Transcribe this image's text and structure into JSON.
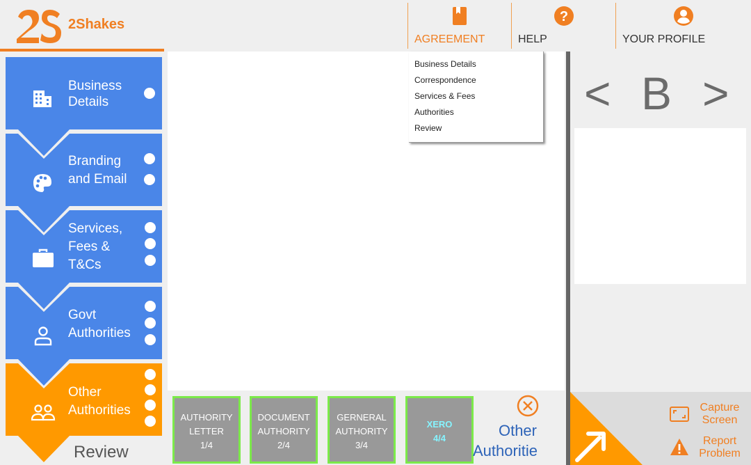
{
  "brand": {
    "name": "2Shakes",
    "mark": "2S"
  },
  "nav": {
    "agreement": "AGREEMENT",
    "help": "HELP",
    "profile": "YOUR PROFILE"
  },
  "dropdown": {
    "items": [
      "Business Details",
      "Correspondence",
      "Services & Fees",
      "Authorities",
      "Review"
    ]
  },
  "steps": [
    {
      "line1": "Business",
      "line2": "Details",
      "line3": "",
      "icon": "building-icon",
      "state": "complete"
    },
    {
      "line1": "Branding",
      "line2": "and Email",
      "line3": "",
      "icon": "palette-icon",
      "state": "complete"
    },
    {
      "line1": "Services,",
      "line2": "Fees &",
      "line3": "T&Cs",
      "icon": "briefcase-icon",
      "state": "complete"
    },
    {
      "line1": "Govt",
      "line2": "Authorities",
      "line3": "",
      "icon": "person-icon",
      "state": "complete"
    },
    {
      "line1": "Other",
      "line2": "Authorities",
      "line3": "",
      "icon": "people-icon",
      "state": "current"
    }
  ],
  "review_label": "Review",
  "documents": [
    {
      "line1": "AUTHORITY",
      "line2": "LETTER",
      "count": "1/4",
      "active": false
    },
    {
      "line1": "DOCUMENT",
      "line2": "AUTHORITY",
      "count": "2/4",
      "active": false
    },
    {
      "line1": "GERNERAL",
      "line2": "AUTHORITY",
      "count": "3/4",
      "active": false
    },
    {
      "line1": "XERO",
      "line2": "",
      "count": "4/4",
      "active": true
    }
  ],
  "other_authorities": {
    "line1": "Other",
    "line2": "Authorities"
  },
  "pager": {
    "prev": "<",
    "current": "B",
    "next": ">"
  },
  "actions": {
    "capture": {
      "line1": "Capture",
      "line2": "Screen"
    },
    "report": {
      "line1": "Report",
      "line2": "Problem"
    }
  },
  "colors": {
    "accent": "#f07f22",
    "step_blue": "#4a86e8",
    "step_orange": "#ff9900",
    "tile_border": "#7cea4a",
    "link_blue": "#2d63b8"
  }
}
